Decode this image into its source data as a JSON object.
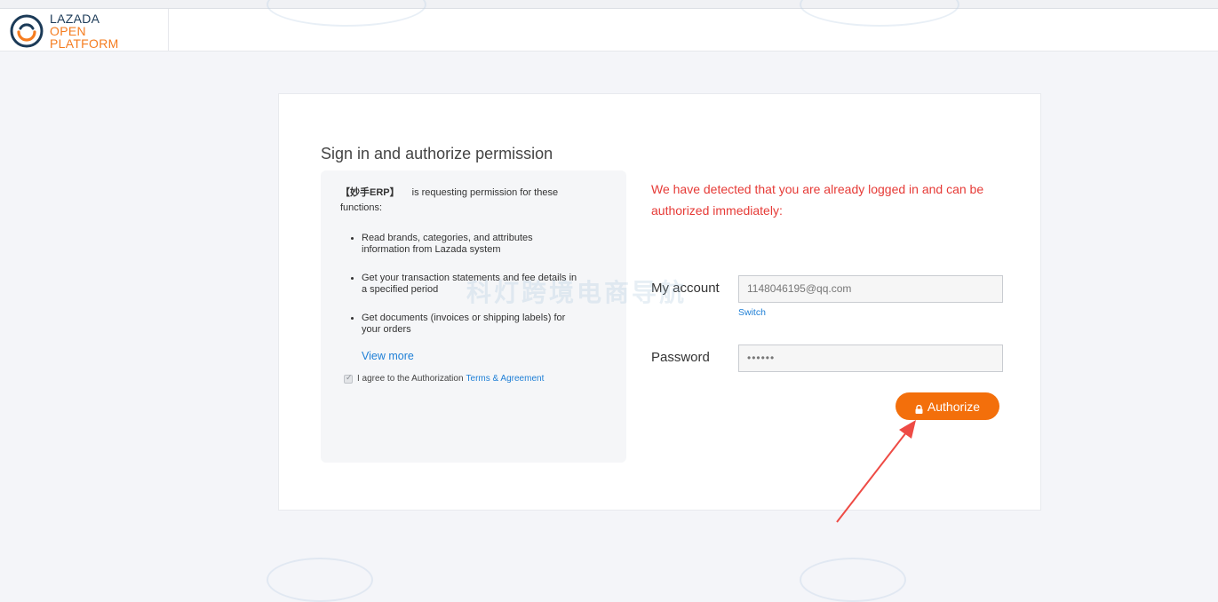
{
  "logo": {
    "line1": "LAZADA",
    "line2": "OPEN",
    "line3": "PLATFORM"
  },
  "card": {
    "title": "Sign in and authorize permission",
    "permissions": {
      "app_name": "【妙手ERP】",
      "intro_text": "is requesting permission for these functions:",
      "items": [
        {
          "text": "Read brands, categories, and attributes information from Lazada system"
        },
        {
          "text": "Get your transaction statements and fee details in a specified period"
        },
        {
          "text": "Get documents (invoices or shipping labels) for your orders"
        }
      ],
      "view_more": "View more",
      "agree_text": "I agree to the Authorization",
      "terms_link": "Terms & Agreement"
    },
    "detected_message": "We have detected that you are already logged in and can be authorized immediately:",
    "account_label": "My account",
    "account_value": "1148046195@qq.com",
    "switch_link": "Switch",
    "password_label": "Password",
    "password_value": "••••••",
    "authorize_button": "Authorize"
  },
  "watermark": "科灯跨境电商导航",
  "colors": {
    "accent_orange": "#f36f0b",
    "link_blue": "#1e7fd6",
    "alert_red": "#e63a36",
    "brand_navy": "#1b3a57"
  }
}
